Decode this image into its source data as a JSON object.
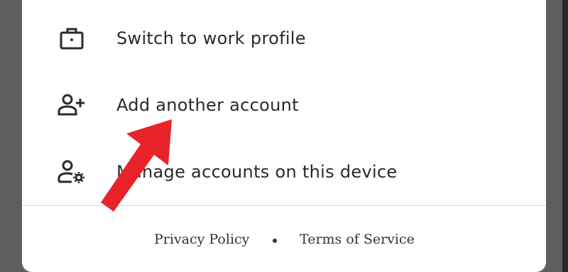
{
  "menu": {
    "items": [
      {
        "label": "Switch to work profile",
        "icon": "briefcase-icon"
      },
      {
        "label": "Add another account",
        "icon": "person-add-icon"
      },
      {
        "label": "Manage accounts on this device",
        "icon": "manage-accounts-icon"
      }
    ]
  },
  "footer": {
    "privacy": "Privacy Policy",
    "terms": "Terms of Service"
  },
  "annotation": {
    "arrow_color": "#e8232a"
  }
}
